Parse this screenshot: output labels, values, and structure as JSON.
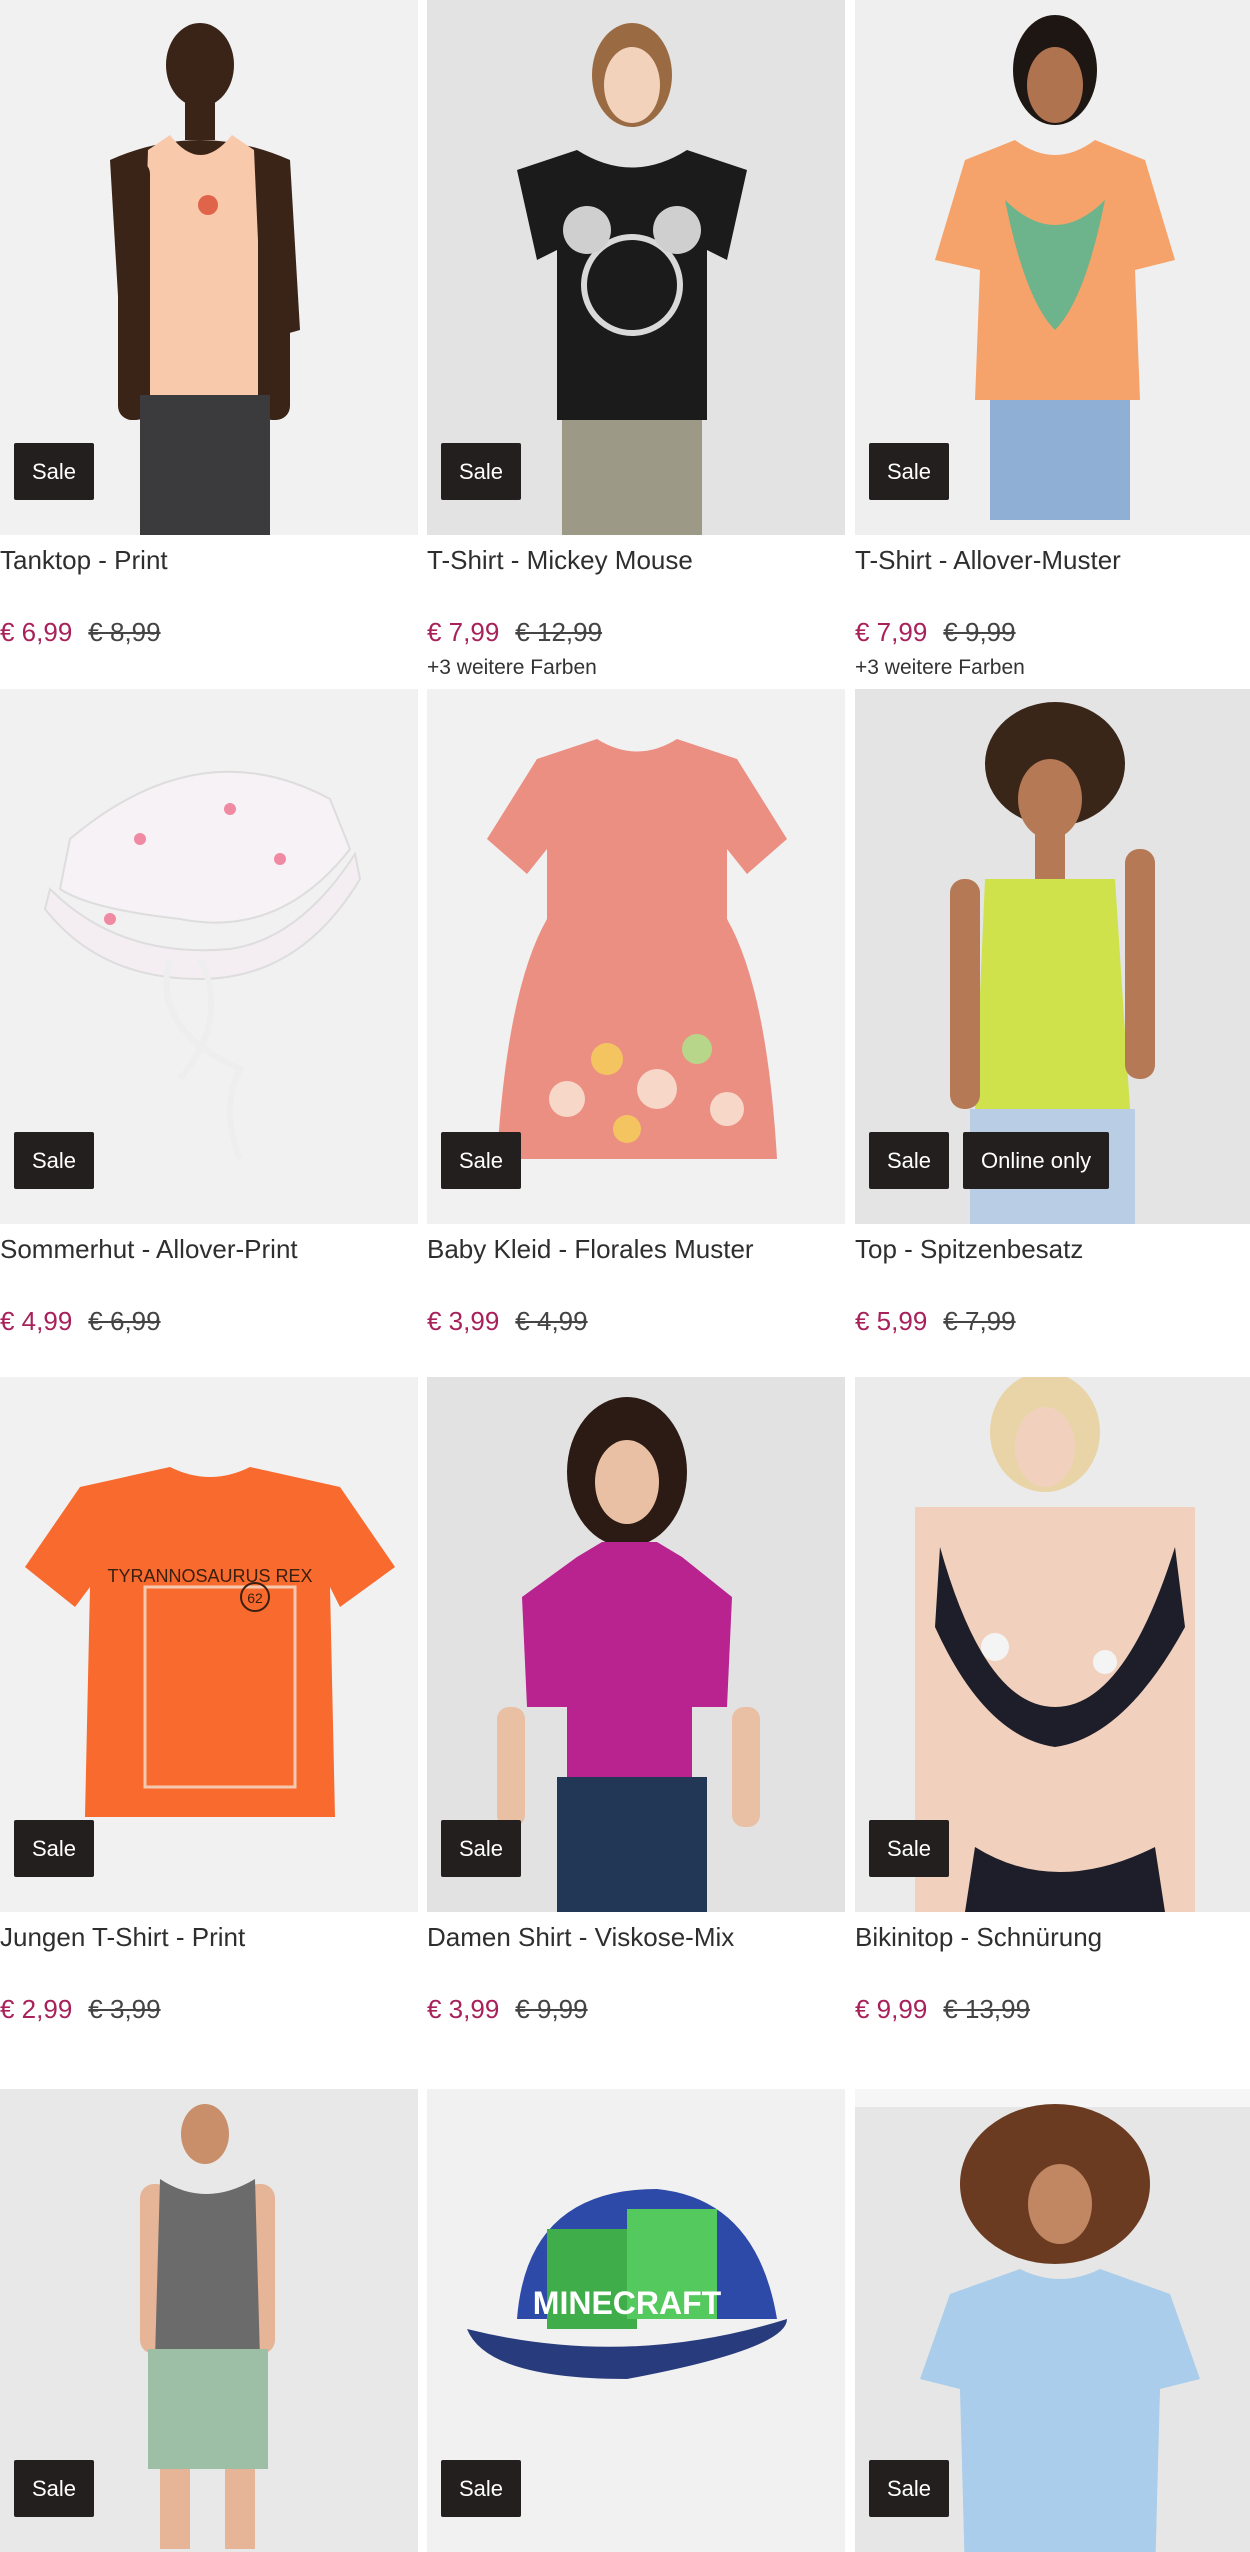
{
  "products": [
    {
      "title": "Tanktop - Print",
      "price": "€ 6,99",
      "old_price": "€ 8,99",
      "badges": [
        "Sale"
      ],
      "more_colors": ""
    },
    {
      "title": "T-Shirt - Mickey Mouse",
      "price": "€ 7,99",
      "old_price": "€ 12,99",
      "badges": [
        "Sale"
      ],
      "more_colors": "+3 weitere Farben"
    },
    {
      "title": "T-Shirt - Allover-Muster",
      "price": "€ 7,99",
      "old_price": "€ 9,99",
      "badges": [
        "Sale"
      ],
      "more_colors": "+3 weitere Farben"
    },
    {
      "title": "Sommerhut - Allover-Print",
      "price": "€ 4,99",
      "old_price": "€ 6,99",
      "badges": [
        "Sale"
      ],
      "more_colors": ""
    },
    {
      "title": "Baby Kleid - Florales Muster",
      "price": "€ 3,99",
      "old_price": "€ 4,99",
      "badges": [
        "Sale"
      ],
      "more_colors": ""
    },
    {
      "title": "Top - Spitzenbesatz",
      "price": "€ 5,99",
      "old_price": "€ 7,99",
      "badges": [
        "Sale",
        "Online only"
      ],
      "more_colors": ""
    },
    {
      "title": "Jungen T-Shirt - Print",
      "price": "€ 2,99",
      "old_price": "€ 3,99",
      "badges": [
        "Sale"
      ],
      "more_colors": ""
    },
    {
      "title": "Damen Shirt - Viskose-Mix",
      "price": "€ 3,99",
      "old_price": "€ 9,99",
      "badges": [
        "Sale"
      ],
      "more_colors": ""
    },
    {
      "title": "Bikinitop - Schnürung",
      "price": "€ 9,99",
      "old_price": "€ 13,99",
      "badges": [
        "Sale"
      ],
      "more_colors": ""
    },
    {
      "title": "",
      "price": "",
      "old_price": "",
      "badges": [
        "Sale"
      ],
      "more_colors": ""
    },
    {
      "title": "",
      "price": "",
      "old_price": "",
      "badges": [
        "Sale"
      ],
      "more_colors": ""
    },
    {
      "title": "",
      "price": "",
      "old_price": "",
      "badges": [
        "Sale"
      ],
      "more_colors": ""
    }
  ],
  "print_texts": {
    "tshirt_dino": "TYRANNOSAURUS REX",
    "dino_number": "62",
    "cap_logo": "MINECRAFT"
  },
  "colors": {
    "sale_price": "#a8215a",
    "badge_bg": "#231f1e"
  }
}
